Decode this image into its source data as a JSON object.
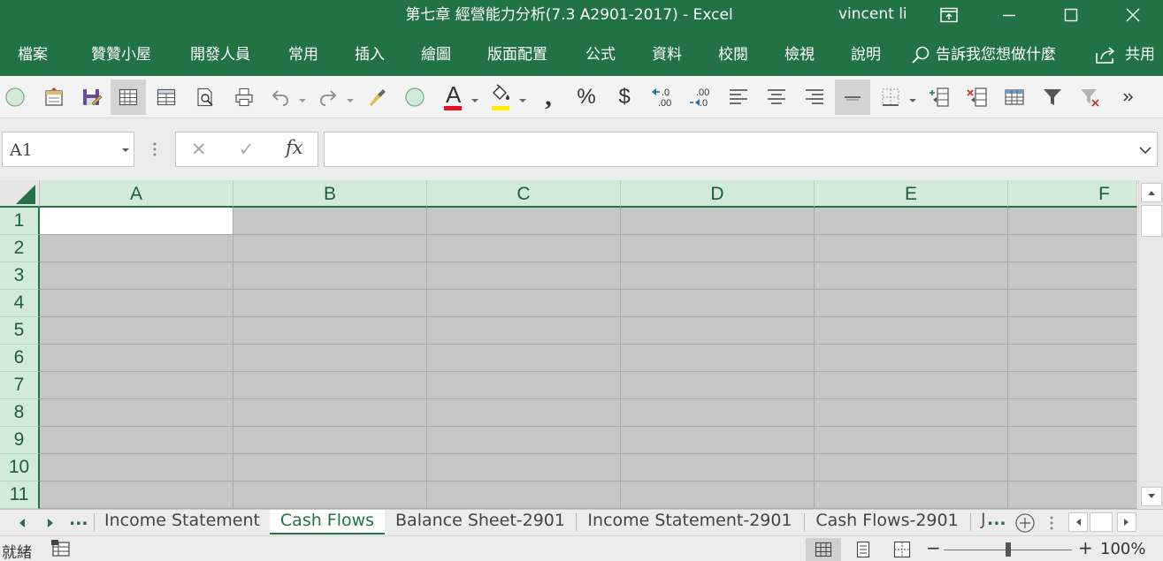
{
  "window": {
    "title": "第七章 經營能力分析(7.3 A2901-2017)  -  Excel",
    "user": "vincent li"
  },
  "menu": {
    "items": [
      "檔案",
      "贊贊小屋",
      "開發人員",
      "常用",
      "插入",
      "繪圖",
      "版面配置",
      "公式",
      "資料",
      "校閱",
      "檢視",
      "說明"
    ],
    "search_hint": "告訴我您想做什麼",
    "share": "共用"
  },
  "toolbar": {
    "icons": [
      "circle-icon",
      "open-file-icon",
      "save-as-icon",
      "grid-view-icon",
      "table-view-icon",
      "print-preview-icon",
      "print-icon",
      "undo-icon",
      "redo-icon",
      "format-painter-icon",
      "circle-icon",
      "font-color-icon",
      "fill-color-icon",
      "comma-style-icon",
      "percent-style-icon",
      "currency-icon",
      "decrease-decimal-icon",
      "increase-decimal-icon",
      "align-left-icon",
      "align-center-icon",
      "align-right-icon",
      "middle-align-icon",
      "borders-icon",
      "insert-column-icon",
      "delete-column-icon",
      "table-icon",
      "filter-icon",
      "clear-filter-icon",
      "more-commands-icon"
    ],
    "font_color_letter": "A",
    "comma_glyph": ",",
    "percent_glyph": "%",
    "currency_glyph": "$",
    "decrease_decimal": ".0\n.00",
    "increase_decimal": ".00\n.0",
    "accent_color": "#217346",
    "font_color": "#e81123",
    "fill_color": "#ffeb00"
  },
  "formula_bar": {
    "name_box": "A1",
    "cancel_glyph": "✕",
    "enter_glyph": "✓",
    "fx_label": "fx",
    "formula": ""
  },
  "grid": {
    "columns": [
      "A",
      "B",
      "C",
      "D",
      "E",
      "F"
    ],
    "rows": [
      "1",
      "2",
      "3",
      "4",
      "5",
      "6",
      "7",
      "8",
      "9",
      "10",
      "11"
    ],
    "active_cell": "A1"
  },
  "sheets": {
    "more": "...",
    "tabs": [
      "Income Statement",
      "Cash Flows",
      "Balance Sheet-2901",
      "Income Statement-2901",
      "Cash Flows-2901"
    ],
    "active": "Cash Flows",
    "truncated_tab": "J"
  },
  "status": {
    "mode": "就緒",
    "zoom": "100%",
    "minus": "−",
    "plus": "+"
  }
}
